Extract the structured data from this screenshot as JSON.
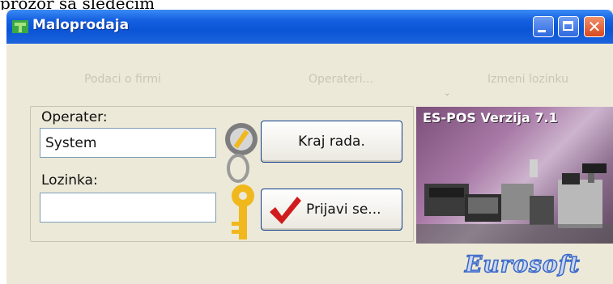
{
  "caption_fragment": "prozor sa sledećim izgledom:",
  "window": {
    "title": "Maloprodaja",
    "close_glyph": "✕"
  },
  "menu": {
    "company_info": "Podaci o firmi",
    "operators": "Operateri...",
    "change_password": "Izmeni lozinku"
  },
  "login": {
    "operator_label": "Operater:",
    "operator_value": "System",
    "password_label": "Lozinka:",
    "password_value": ""
  },
  "buttons": {
    "exit": "Kraj rada.",
    "login": "Prijavi se..."
  },
  "promo": {
    "title": "ES-POS Verzija 7.1"
  },
  "brand": "Eurosoft",
  "icons": {
    "app": "app-icon",
    "key": "key-icon",
    "check": "checkmark-icon",
    "minimize": "minimize-icon",
    "maximize": "maximize-icon",
    "close": "close-icon"
  },
  "colors": {
    "titlebar": "#0a55d6",
    "window_bg": "#ece9d8",
    "check_red": "#d01c1c",
    "key_yellow": "#f0b81c"
  }
}
